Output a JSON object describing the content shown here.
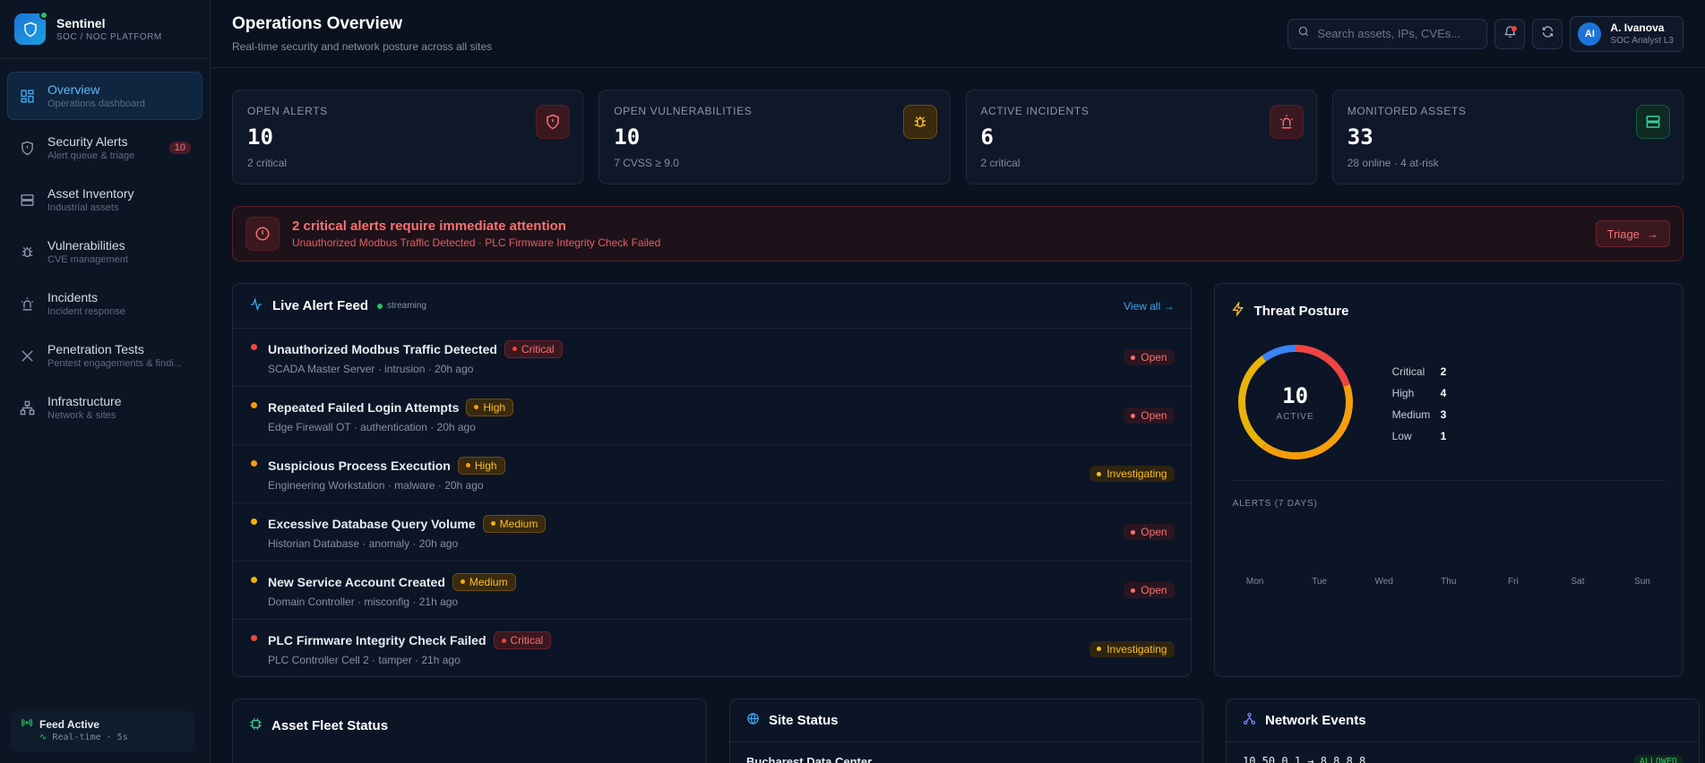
{
  "brand": {
    "name": "Sentinel",
    "subtitle": "SOC / NOC PLATFORM"
  },
  "sidebar": {
    "items": [
      {
        "label": "Overview",
        "sub": "Operations dashboard",
        "icon": "grid-icon",
        "active": true
      },
      {
        "label": "Security Alerts",
        "sub": "Alert queue & triage",
        "icon": "shield-icon",
        "badge": "10"
      },
      {
        "label": "Asset Inventory",
        "sub": "Industrial assets",
        "icon": "server-icon"
      },
      {
        "label": "Vulnerabilities",
        "sub": "CVE management",
        "icon": "bug-icon"
      },
      {
        "label": "Incidents",
        "sub": "Incident response",
        "icon": "siren-icon"
      },
      {
        "label": "Penetration Tests",
        "sub": "Pentest engagements & findi...",
        "icon": "swords-icon"
      },
      {
        "label": "Infrastructure",
        "sub": "Network & sites",
        "icon": "network-icon"
      }
    ],
    "feed": {
      "title": "Feed Active",
      "sub": "Real-time · 5s"
    }
  },
  "header": {
    "title": "Operations Overview",
    "subtitle": "Real-time security and network posture across all sites",
    "search_placeholder": "Search assets, IPs, CVEs...",
    "user": {
      "initials": "AI",
      "name": "A. Ivanova",
      "role": "SOC Analyst L3"
    }
  },
  "kpis": [
    {
      "label": "OPEN ALERTS",
      "value": "10",
      "sub": "2 critical",
      "icon": "shield-alert-icon",
      "color": "#f87171"
    },
    {
      "label": "OPEN VULNERABILITIES",
      "value": "10",
      "sub": "7 CVSS ≥ 9.0",
      "icon": "bug-icon",
      "color": "#fbbf24"
    },
    {
      "label": "ACTIVE INCIDENTS",
      "value": "6",
      "sub": "2 critical",
      "icon": "siren-icon",
      "color": "#f87171"
    },
    {
      "label": "MONITORED ASSETS",
      "value": "33",
      "sub": "28 online · 4 at-risk",
      "icon": "server-icon",
      "color": "#34d399"
    }
  ],
  "banner": {
    "title": "2 critical alerts require immediate attention",
    "sub": "Unauthorized Modbus Traffic Detected · PLC Firmware Integrity Check Failed",
    "button": "Triage"
  },
  "feed_panel": {
    "title": "Live Alert Feed",
    "streaming": "streaming",
    "view_all": "View all →",
    "rows": [
      {
        "title": "Unauthorized Modbus Traffic Detected",
        "severity": "Critical",
        "sub": "SCADA Master Server · intrusion · 20h ago",
        "status": "Open"
      },
      {
        "title": "Repeated Failed Login Attempts",
        "severity": "High",
        "sub": "Edge Firewall OT · authentication · 20h ago",
        "status": "Open"
      },
      {
        "title": "Suspicious Process Execution",
        "severity": "High",
        "sub": "Engineering Workstation · malware · 20h ago",
        "status": "Investigating"
      },
      {
        "title": "Excessive Database Query Volume",
        "severity": "Medium",
        "sub": "Historian Database · anomaly · 20h ago",
        "status": "Open"
      },
      {
        "title": "New Service Account Created",
        "severity": "Medium",
        "sub": "Domain Controller · misconfig · 21h ago",
        "status": "Open"
      },
      {
        "title": "PLC Firmware Integrity Check Failed",
        "severity": "Critical",
        "sub": "PLC Controller Cell 2 · tamper · 21h ago",
        "status": "Investigating"
      }
    ]
  },
  "threat": {
    "title": "Threat Posture",
    "total": "10",
    "total_label": "ACTIVE",
    "legend": [
      {
        "name": "Critical",
        "value": 2
      },
      {
        "name": "High",
        "value": 4
      },
      {
        "name": "Medium",
        "value": 3
      },
      {
        "name": "Low",
        "value": 1
      }
    ],
    "colors": {
      "Critical": "#ef4444",
      "High": "#f59e0b",
      "Medium": "#eab308",
      "Low": "#3b82f6"
    },
    "week_title": "ALERTS (7 DAYS)",
    "days": [
      "Mon",
      "Tue",
      "Wed",
      "Thu",
      "Fri",
      "Sat",
      "Sun"
    ]
  },
  "bottom": {
    "fleet": {
      "title": "Asset Fleet Status"
    },
    "site": {
      "title": "Site Status",
      "first": "Bucharest Data Center"
    },
    "network": {
      "title": "Network Events",
      "first": "10.50.0.1 → 8.8.8.8",
      "tag": "ALLOWED"
    }
  }
}
